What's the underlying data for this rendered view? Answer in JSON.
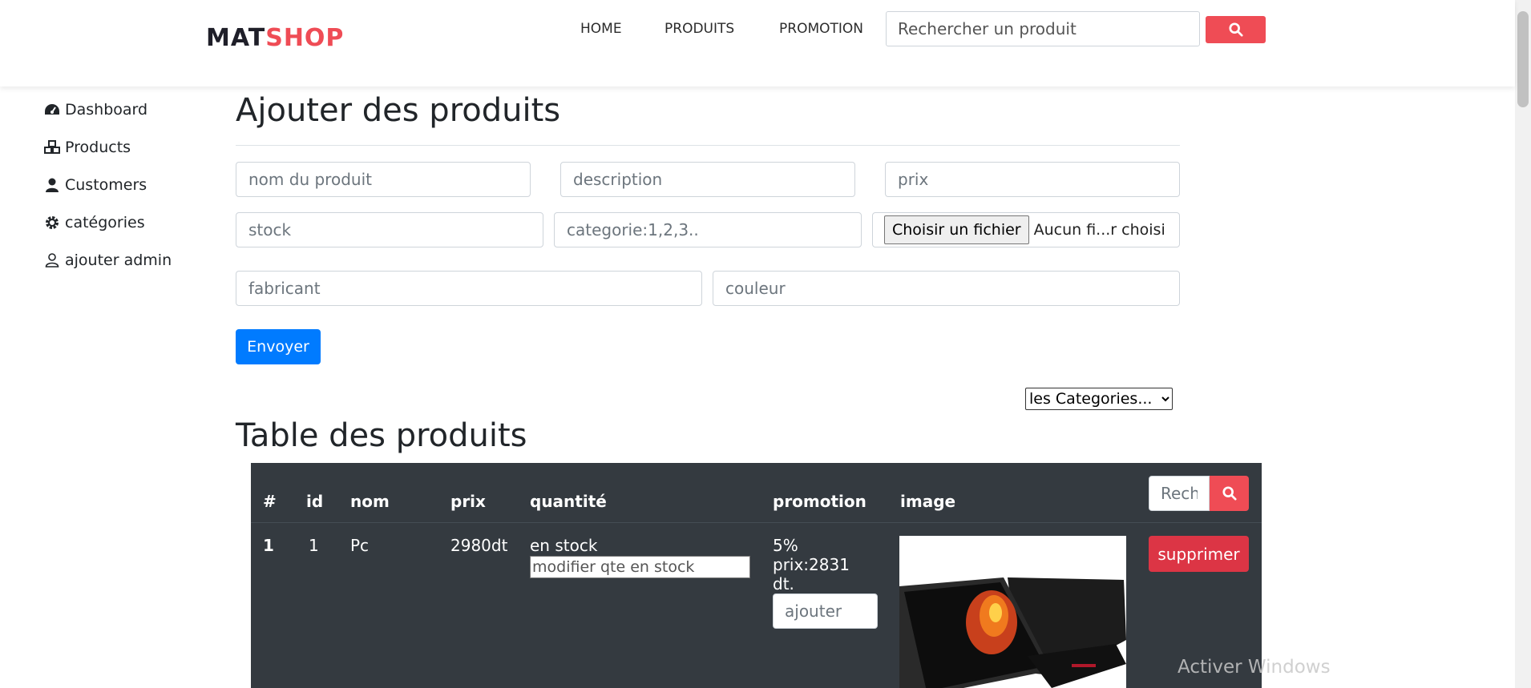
{
  "brand": {
    "part1": "MAT",
    "part2": "SHOP"
  },
  "nav": {
    "links": [
      "HOME",
      "PRODUITS",
      "PROMOTION"
    ],
    "search_placeholder": "Rechercher un produit",
    "search_icon": "search-icon"
  },
  "sidebar": {
    "items": [
      {
        "label": "Dashboard",
        "icon": "tachometer-icon"
      },
      {
        "label": "Products",
        "icon": "cubes-icon"
      },
      {
        "label": "Customers",
        "icon": "user-icon"
      },
      {
        "label": "catégories",
        "icon": "gear-icon"
      },
      {
        "label": "ajouter admin",
        "icon": "user-outline-icon"
      }
    ]
  },
  "form": {
    "title": "Ajouter des produits",
    "placeholders": {
      "nom": "nom du produit",
      "description": "description",
      "prix": "prix",
      "stock": "stock",
      "categorie": "categorie:1,2,3..",
      "fabricant": "fabricant",
      "couleur": "couleur"
    },
    "file_button": "Choisir un fichier",
    "file_status": "Aucun fi...r choisi",
    "submit": "Envoyer",
    "category_select": "les Categories..."
  },
  "table": {
    "title": "Table des produits",
    "headers": [
      "#",
      "id",
      "nom",
      "prix",
      "quantité",
      "promotion",
      "image"
    ],
    "search_placeholder": "Rech",
    "rows": [
      {
        "index": "1",
        "id": "1",
        "nom": "Pc",
        "prix": "2980dt",
        "quantite_status": "en stock",
        "quantite_placeholder": "modifier qte en stock",
        "promo_percent": "5%",
        "promo_price_1": "prix:2831",
        "promo_price_2": "dt.",
        "promo_input_placeholder": "ajouter",
        "delete_label": "supprimer"
      }
    ]
  },
  "watermark": "Activer Windows",
  "colors": {
    "accent": "#ef4c55",
    "primary": "#007bff",
    "danger": "#dc3545",
    "table_bg": "#343a40"
  }
}
